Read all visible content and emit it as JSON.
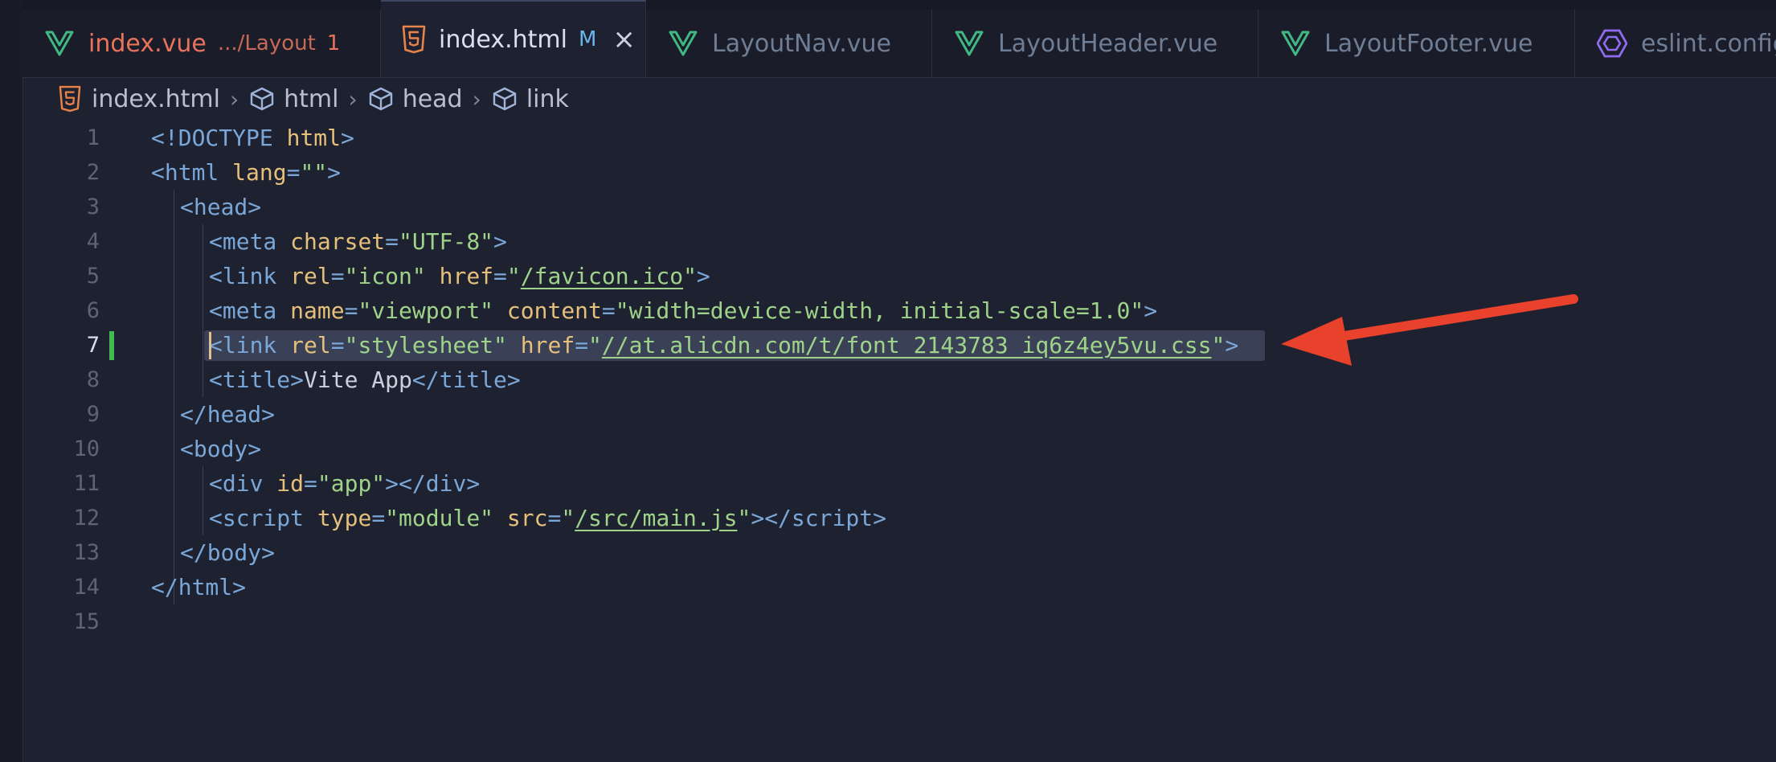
{
  "tabs": [
    {
      "label": "index.vue",
      "path": ".../Layout",
      "count": "1",
      "icon": "vue-icon",
      "state": "error"
    },
    {
      "label": "index.html",
      "modified": "M",
      "icon": "html5-icon",
      "state": "active",
      "close": "×"
    },
    {
      "label": "LayoutNav.vue",
      "icon": "vue-icon"
    },
    {
      "label": "LayoutHeader.vue",
      "icon": "vue-icon"
    },
    {
      "label": "LayoutFooter.vue",
      "icon": "vue-icon"
    },
    {
      "label": "eslint.config",
      "icon": "eslint-icon"
    }
  ],
  "breadcrumb": [
    {
      "label": "index.html",
      "icon": "html5-icon"
    },
    {
      "label": "html",
      "icon": "symbol-cube-icon"
    },
    {
      "label": "head",
      "icon": "symbol-cube-icon"
    },
    {
      "label": "link",
      "icon": "symbol-cube-icon"
    }
  ],
  "editor": {
    "current_line": 7,
    "lines": [
      {
        "n": "1",
        "indent": 0,
        "tokens": [
          [
            "pun",
            "<!"
          ],
          [
            "tag",
            "DOCTYPE"
          ],
          [
            "txt",
            " "
          ],
          [
            "attr",
            "html"
          ],
          [
            "pun",
            ">"
          ]
        ]
      },
      {
        "n": "2",
        "indent": 0,
        "tokens": [
          [
            "pun",
            "<"
          ],
          [
            "tag",
            "html"
          ],
          [
            "txt",
            " "
          ],
          [
            "attr",
            "lang"
          ],
          [
            "pun",
            "="
          ],
          [
            "str",
            "\"\""
          ],
          [
            "pun",
            ">"
          ]
        ]
      },
      {
        "n": "3",
        "indent": 1,
        "tokens": [
          [
            "pun",
            "<"
          ],
          [
            "tag",
            "head"
          ],
          [
            "pun",
            ">"
          ]
        ]
      },
      {
        "n": "4",
        "indent": 2,
        "tokens": [
          [
            "pun",
            "<"
          ],
          [
            "tag",
            "meta"
          ],
          [
            "txt",
            " "
          ],
          [
            "attr",
            "charset"
          ],
          [
            "pun",
            "="
          ],
          [
            "str",
            "\"UTF-8\""
          ],
          [
            "pun",
            ">"
          ]
        ]
      },
      {
        "n": "5",
        "indent": 2,
        "tokens": [
          [
            "pun",
            "<"
          ],
          [
            "tag",
            "link"
          ],
          [
            "txt",
            " "
          ],
          [
            "attr",
            "rel"
          ],
          [
            "pun",
            "="
          ],
          [
            "str",
            "\"icon\""
          ],
          [
            "txt",
            " "
          ],
          [
            "attr",
            "href"
          ],
          [
            "pun",
            "="
          ],
          [
            "str",
            "\""
          ],
          [
            "url",
            "/favicon.ico"
          ],
          [
            "str",
            "\""
          ],
          [
            "pun",
            ">"
          ]
        ]
      },
      {
        "n": "6",
        "indent": 2,
        "tokens": [
          [
            "pun",
            "<"
          ],
          [
            "tag",
            "meta"
          ],
          [
            "txt",
            " "
          ],
          [
            "attr",
            "name"
          ],
          [
            "pun",
            "="
          ],
          [
            "str",
            "\"viewport\""
          ],
          [
            "txt",
            " "
          ],
          [
            "attr",
            "content"
          ],
          [
            "pun",
            "="
          ],
          [
            "str",
            "\"width=device-width, initial-scale=1.0\""
          ],
          [
            "pun",
            ">"
          ]
        ]
      },
      {
        "n": "7",
        "indent": 2,
        "tokens": [
          [
            "pun",
            "<"
          ],
          [
            "tag",
            "link"
          ],
          [
            "txt",
            " "
          ],
          [
            "attr",
            "rel"
          ],
          [
            "pun",
            "="
          ],
          [
            "str",
            "\"stylesheet\""
          ],
          [
            "txt",
            " "
          ],
          [
            "attr",
            "href"
          ],
          [
            "pun",
            "="
          ],
          [
            "str",
            "\""
          ],
          [
            "url",
            "//at.alicdn.com/t/font_2143783_iq6z4ey5vu.css"
          ],
          [
            "str",
            "\""
          ],
          [
            "pun",
            ">"
          ]
        ]
      },
      {
        "n": "8",
        "indent": 2,
        "tokens": [
          [
            "pun",
            "<"
          ],
          [
            "tag",
            "title"
          ],
          [
            "pun",
            ">"
          ],
          [
            "txt",
            "Vite App"
          ],
          [
            "pun",
            "</"
          ],
          [
            "tag",
            "title"
          ],
          [
            "pun",
            ">"
          ]
        ]
      },
      {
        "n": "9",
        "indent": 1,
        "tokens": [
          [
            "pun",
            "</"
          ],
          [
            "tag",
            "head"
          ],
          [
            "pun",
            ">"
          ]
        ]
      },
      {
        "n": "10",
        "indent": 1,
        "tokens": [
          [
            "pun",
            "<"
          ],
          [
            "tag",
            "body"
          ],
          [
            "pun",
            ">"
          ]
        ]
      },
      {
        "n": "11",
        "indent": 2,
        "tokens": [
          [
            "pun",
            "<"
          ],
          [
            "tag",
            "div"
          ],
          [
            "txt",
            " "
          ],
          [
            "attr",
            "id"
          ],
          [
            "pun",
            "="
          ],
          [
            "str",
            "\"app\""
          ],
          [
            "pun",
            "></"
          ],
          [
            "tag",
            "div"
          ],
          [
            "pun",
            ">"
          ]
        ]
      },
      {
        "n": "12",
        "indent": 2,
        "tokens": [
          [
            "pun",
            "<"
          ],
          [
            "tag",
            "script"
          ],
          [
            "txt",
            " "
          ],
          [
            "attr",
            "type"
          ],
          [
            "pun",
            "="
          ],
          [
            "str",
            "\"module\""
          ],
          [
            "txt",
            " "
          ],
          [
            "attr",
            "src"
          ],
          [
            "pun",
            "="
          ],
          [
            "str",
            "\""
          ],
          [
            "url",
            "/src/main.js"
          ],
          [
            "str",
            "\""
          ],
          [
            "pun",
            "></"
          ],
          [
            "tag",
            "script"
          ],
          [
            "pun",
            ">"
          ]
        ]
      },
      {
        "n": "13",
        "indent": 1,
        "tokens": [
          [
            "pun",
            "</"
          ],
          [
            "tag",
            "body"
          ],
          [
            "pun",
            ">"
          ]
        ]
      },
      {
        "n": "14",
        "indent": 0,
        "tokens": [
          [
            "pun",
            "</"
          ],
          [
            "tag",
            "html"
          ],
          [
            "pun",
            ">"
          ]
        ]
      },
      {
        "n": "15",
        "indent": 0,
        "tokens": []
      }
    ]
  },
  "annotation": {
    "color": "#e8412c"
  }
}
